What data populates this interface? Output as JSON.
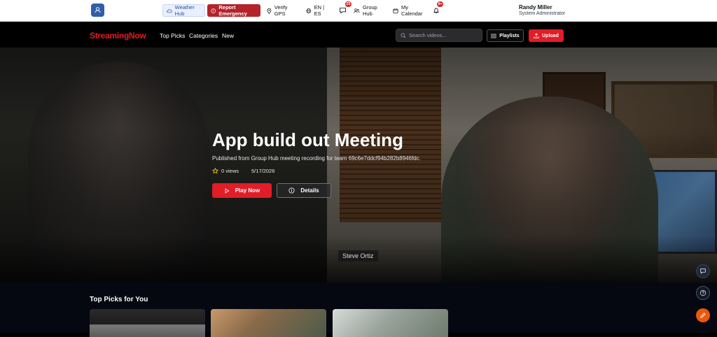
{
  "topbar": {
    "weather_hub": "Weather Hub",
    "report_emergency": "Report Emergency",
    "verify_gps": "Verify GPS",
    "language": "EN | ES",
    "messages_badge": "25",
    "group_hub": "Group Hub",
    "my_calendar": "My Calendar",
    "notifications_badge": "9+",
    "user_name": "Randy Miller",
    "user_role": "System Administrator"
  },
  "nav": {
    "brand": "StreamingNow",
    "links": [
      "Top Picks",
      "Categories",
      "New"
    ],
    "search_placeholder": "Search videos...",
    "playlists": "Playlists",
    "upload": "Upload"
  },
  "hero": {
    "title": "App build out Meeting",
    "description": "Published from Group Hub meeting recording for team 69c6e7ddcf94b282b8946fdc.",
    "views": "0 views",
    "date": "5/17/2026",
    "play_now": "Play Now",
    "details": "Details",
    "participant_name": "Steve Ortiz"
  },
  "section": {
    "title": "Top Picks for You"
  },
  "colors": {
    "brand_red": "#e11d27",
    "emergency_red": "#b4232c",
    "fab_orange": "#ea580c"
  }
}
